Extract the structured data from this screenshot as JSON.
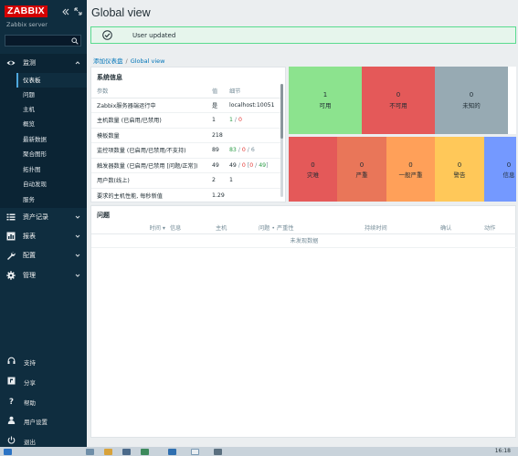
{
  "app": {
    "logo_text": "ZABBIX",
    "server_name": "Zabbix server",
    "search": {
      "placeholder": "",
      "value": ""
    }
  },
  "nav": {
    "monitoring": {
      "label": "监测",
      "items": [
        "仪表板",
        "问题",
        "主机",
        "概览",
        "最新数据",
        "聚合图形",
        "拓扑图",
        "自动发现",
        "服务"
      ]
    },
    "groups": [
      {
        "label": "资产记录",
        "icon": "list-icon"
      },
      {
        "label": "报表",
        "icon": "report-icon"
      },
      {
        "label": "配置",
        "icon": "wrench-icon"
      },
      {
        "label": "管理",
        "icon": "gear-icon"
      }
    ],
    "bottom": [
      {
        "label": "支持",
        "icon": "headset-icon"
      },
      {
        "label": "分享",
        "icon": "share-icon"
      },
      {
        "label": "帮助",
        "icon": "help-icon"
      },
      {
        "label": "用户设置",
        "icon": "user-icon"
      },
      {
        "label": "退出",
        "icon": "power-icon"
      }
    ]
  },
  "page": {
    "title": "Global view",
    "message": "User updated",
    "breadcrumb": [
      "添加仪表盘",
      "Global view"
    ]
  },
  "system_info": {
    "title": "系统信息",
    "headers": [
      "参数",
      "值",
      "细节"
    ],
    "rows": [
      {
        "param": "Zabbix服务器端运行中",
        "value": "是",
        "detail": "localhost:10051"
      },
      {
        "param": "主机数量 (已启用/已禁用)",
        "value": "1",
        "d1": "1",
        "d2": "0"
      },
      {
        "param": "模板数量",
        "value": "218"
      },
      {
        "param": "监控项数量 (已启用/已禁用/不支持)",
        "value": "89",
        "d1": "83",
        "d2": "0",
        "d3": "6"
      },
      {
        "param": "触发器数量 (已启用/已禁用 [问题/正常])",
        "value": "49",
        "d1": "49",
        "d2": "0",
        "d3": "0",
        "d4": "49"
      },
      {
        "param": "用户数(线上)",
        "value": "2",
        "d1": "1"
      },
      {
        "param": "要求的主机性能, 每秒新值",
        "value": "1.29"
      }
    ]
  },
  "host_availability": [
    {
      "count": "1",
      "label": "可用",
      "color": "#8ce38e"
    },
    {
      "count": "0",
      "label": "不可用",
      "color": "#e45959"
    },
    {
      "count": "0",
      "label": "未知的",
      "color": "#97aab3"
    }
  ],
  "problems_by_severity": [
    {
      "count": "0",
      "label": "灾难",
      "color": "#e45959"
    },
    {
      "count": "0",
      "label": "严重",
      "color": "#e97659"
    },
    {
      "count": "0",
      "label": "一般严重",
      "color": "#ffa059"
    },
    {
      "count": "0",
      "label": "警告",
      "color": "#ffc859"
    },
    {
      "count": "0",
      "label": "信息",
      "color": "#7499ff"
    }
  ],
  "problems": {
    "title": "问题",
    "headers": [
      "时间 ▾",
      "信息",
      "主机",
      "问题 • 严重性",
      "持续时间",
      "确认",
      "动作"
    ],
    "empty_text": "未发现数据"
  },
  "taskbar": {
    "time": "16:18"
  }
}
